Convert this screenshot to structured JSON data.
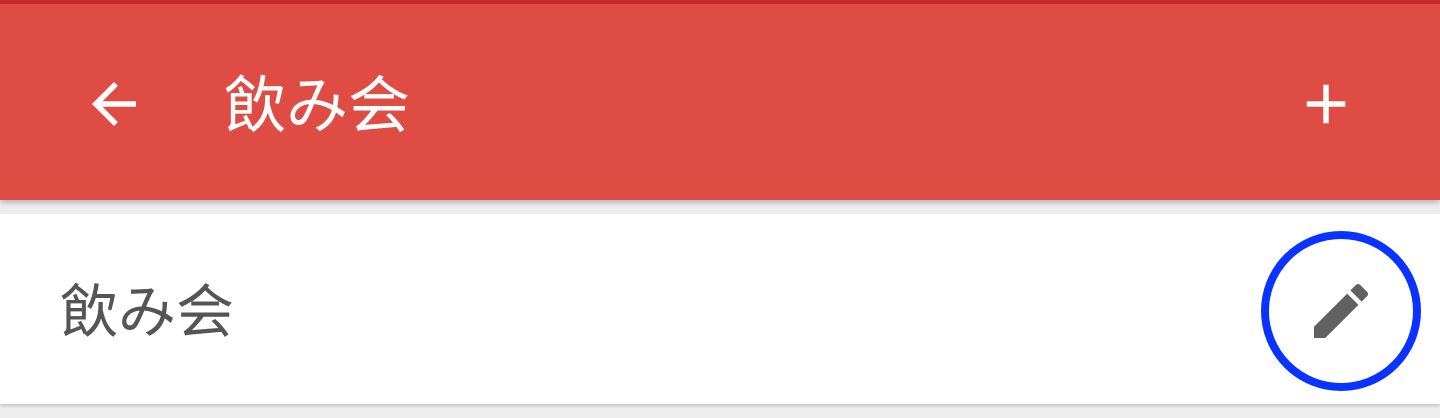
{
  "toolbar": {
    "title": "飲み会",
    "back_icon": "arrow-left-icon",
    "add_icon": "plus-icon",
    "color": "#de4c43"
  },
  "list": {
    "items": [
      {
        "label": "飲み会",
        "edit_icon": "pencil-icon"
      }
    ]
  },
  "highlight_color": "#0a33ff"
}
